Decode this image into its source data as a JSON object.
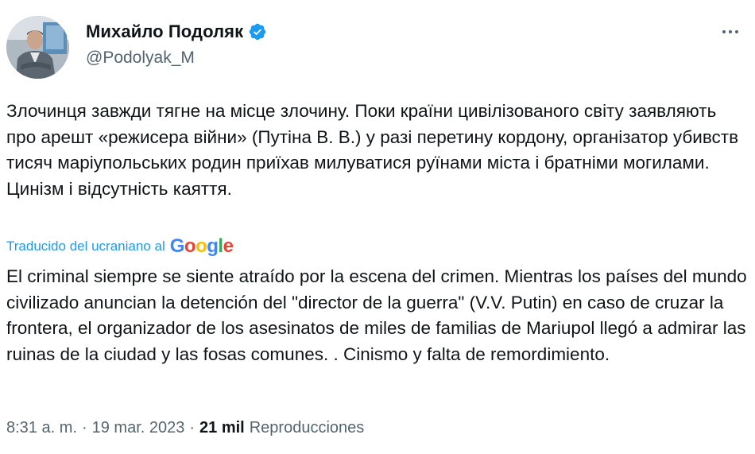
{
  "author": {
    "display_name": "Михайло Подоляк",
    "handle": "@Podolyak_M",
    "verified_icon": "verified-badge-icon",
    "avatar_icon": "avatar"
  },
  "tweet": {
    "original_text": "Злочинця завжди тягне на місце злочину. Поки країни цивілізованого світу заявляють про арешт «режисера війни» (Путіна В. В.) у разі перетину кордону, організатор убивств тисяч маріупольських родин приїхав милуватися руїнами міста і братніми могилами. Цинізм і відсутність каяття.",
    "translated_by_label": "Traducido del ucraniano al",
    "translator_brand": "Google",
    "translated_text": "El criminal siempre se siente atraído por la escena del crimen. Mientras los países del mundo civilizado anuncian la detención del \"director de la guerra\" (V.V. Putin) en caso de cruzar la frontera, el organizador de los asesinatos de miles de familias de Mariupol llegó a admirar las ruinas de la ciudad y las fosas comunes. . Cinismo y falta de remordimiento."
  },
  "meta": {
    "time": "8:31 a. m.",
    "separator": "·",
    "date": "19 mar. 2023",
    "views_count": "21 mil",
    "views_label": "Reproducciones"
  },
  "colors": {
    "text": "#0f1419",
    "secondary": "#536471",
    "link": "#1d9bf0",
    "verified": "#1d9bf0",
    "google_blue": "#4285f4",
    "google_red": "#ea4335",
    "google_yellow": "#fbbc05",
    "google_green": "#34a853"
  },
  "icons": {
    "more": "more-dots-icon"
  }
}
